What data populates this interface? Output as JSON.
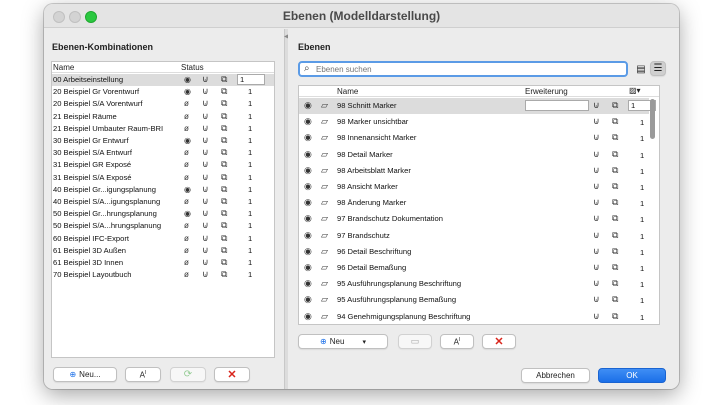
{
  "window": {
    "title": "Ebenen (Modelldarstellung)"
  },
  "left_panel": {
    "title": "Ebenen-Kombinationen",
    "col_name": "Name",
    "col_status": "Status",
    "rows": [
      {
        "name": "00 Arbeitseinstellung",
        "vis": "eye",
        "num": "1"
      },
      {
        "name": "20 Beispiel Gr Vorentwurf",
        "vis": "eye",
        "num": "1"
      },
      {
        "name": "20 Beispiel S/A Vorentwurf",
        "vis": "eye-off",
        "num": "1"
      },
      {
        "name": "21 Beispiel Räume",
        "vis": "eye-off",
        "num": "1"
      },
      {
        "name": "21 Beispiel Umbauter Raum-BRI",
        "vis": "eye-off",
        "num": "1"
      },
      {
        "name": "30 Beispiel Gr Entwurf",
        "vis": "eye",
        "num": "1"
      },
      {
        "name": "30 Beispiel S/A Entwurf",
        "vis": "eye-off",
        "num": "1"
      },
      {
        "name": "31 Beispiel GR Exposé",
        "vis": "eye-off",
        "num": "1"
      },
      {
        "name": "31 Beispiel S/A Exposé",
        "vis": "eye-off",
        "num": "1"
      },
      {
        "name": "40 Beispiel Gr...igungsplanung",
        "vis": "eye",
        "num": "1"
      },
      {
        "name": "40 Beispiel S/A...igungsplanung",
        "vis": "eye-off",
        "num": "1"
      },
      {
        "name": "50 Beispiel Gr...hrungsplanung",
        "vis": "eye",
        "num": "1"
      },
      {
        "name": "50 Beispiel S/A...hrungsplanung",
        "vis": "eye-off",
        "num": "1"
      },
      {
        "name": "60 Beispiel IFC-Export",
        "vis": "eye-off",
        "num": "1"
      },
      {
        "name": "61 Beispiel 3D Außen",
        "vis": "eye-off",
        "num": "1"
      },
      {
        "name": "61 Beispiel 3D Innen",
        "vis": "eye-off",
        "num": "1"
      },
      {
        "name": "70 Beispiel Layoutbuch",
        "vis": "eye-off",
        "num": "1"
      }
    ],
    "buttons": {
      "new": "Neu...",
      "rename": "A",
      "rename_sup": "I"
    }
  },
  "right_panel": {
    "title": "Ebenen",
    "search_placeholder": "Ebenen suchen",
    "col_name": "Name",
    "col_ext": "Erweiterung",
    "rows": [
      {
        "name": "98 Schnitt Marker",
        "num": "1"
      },
      {
        "name": "98 Marker unsichtbar",
        "num": "1"
      },
      {
        "name": "98 Innenansicht Marker",
        "num": "1"
      },
      {
        "name": "98 Detail Marker",
        "num": "1"
      },
      {
        "name": "98 Arbeitsblatt Marker",
        "num": "1"
      },
      {
        "name": "98 Ansicht Marker",
        "num": "1"
      },
      {
        "name": "98 Änderung Marker",
        "num": "1"
      },
      {
        "name": "97 Brandschutz Dokumentation",
        "num": "1"
      },
      {
        "name": "97 Brandschutz",
        "num": "1"
      },
      {
        "name": "96 Detail Beschriftung",
        "num": "1"
      },
      {
        "name": "96 Detail Bemaßung",
        "num": "1"
      },
      {
        "name": "95 Ausführungsplanung Beschriftung",
        "num": "1"
      },
      {
        "name": "95 Ausführungsplanung Bemaßung",
        "num": "1"
      },
      {
        "name": "94 Genehmigungsplanung Beschriftung",
        "num": "1"
      }
    ],
    "buttons": {
      "new": "Neu",
      "rename": "A",
      "rename_sup": "I"
    }
  },
  "footer": {
    "cancel": "Abbrechen",
    "ok": "OK"
  },
  "colors": {
    "accent": "#1b6fe8",
    "delete": "#d9251c",
    "selection": "#dcdcdc"
  }
}
